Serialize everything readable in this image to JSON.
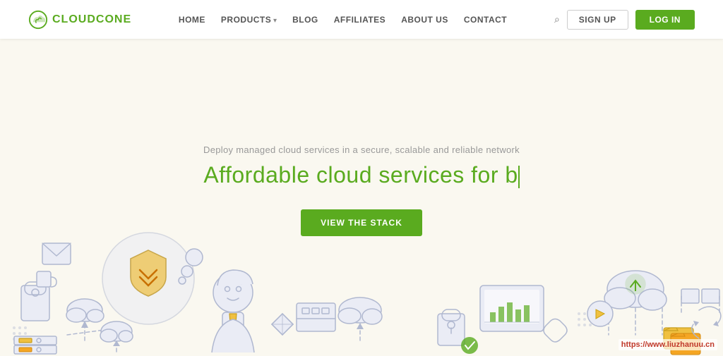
{
  "navbar": {
    "logo_text": "CLOUDCONE",
    "nav_items": [
      {
        "label": "HOME",
        "has_dropdown": false
      },
      {
        "label": "PRODUCTS",
        "has_dropdown": true
      },
      {
        "label": "BLOG",
        "has_dropdown": false
      },
      {
        "label": "AFFILIATES",
        "has_dropdown": false
      },
      {
        "label": "ABOUT US",
        "has_dropdown": false
      },
      {
        "label": "CONTACT",
        "has_dropdown": false
      }
    ],
    "signup_label": "SIGN UP",
    "login_label": "LOG IN"
  },
  "hero": {
    "subtitle": "Deploy managed cloud services in a secure, scalable and reliable network",
    "title_prefix": "Affordable cloud services for b",
    "cta_label": "VIEW THE STACK"
  },
  "watermark": {
    "text": "https://www.liuzhanuu.cn"
  }
}
